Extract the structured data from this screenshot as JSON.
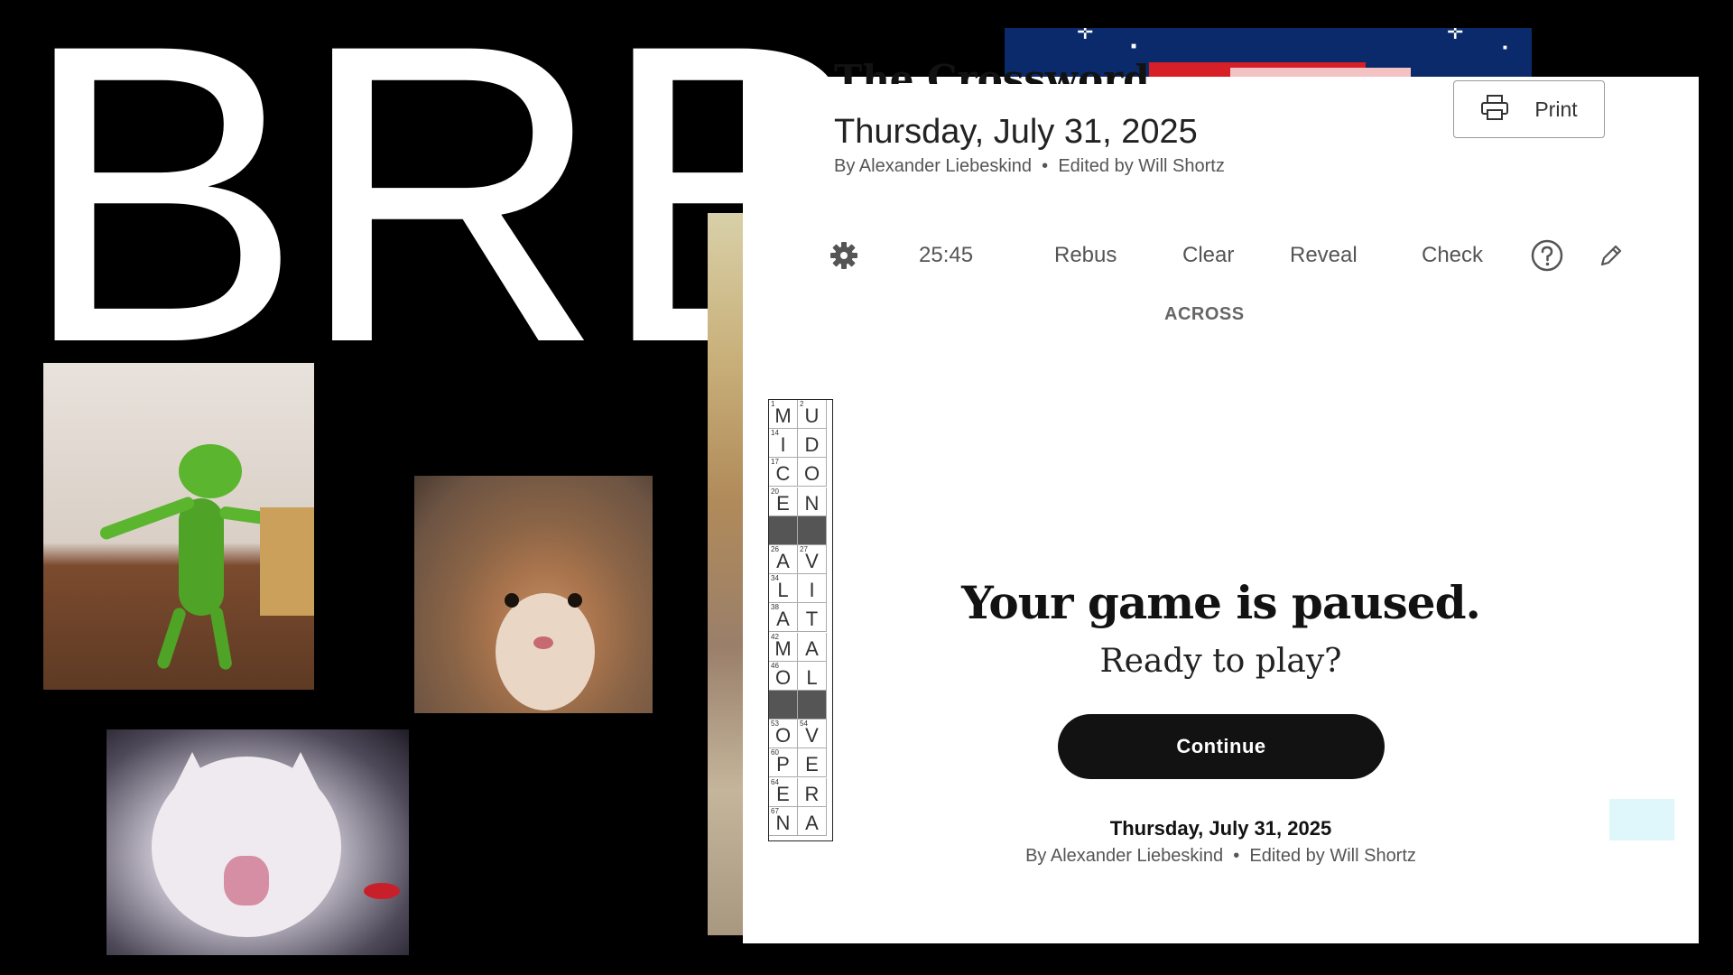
{
  "overlay": {
    "brb_text": "BRB"
  },
  "puzzle": {
    "title_cut": "The Crossword",
    "date": "Thursday, July 31, 2025",
    "author": "By Alexander Liebeskind",
    "separator": "•",
    "editor": "Edited by Will Shortz",
    "print_label": "Print"
  },
  "toolbar": {
    "timer": "25:45",
    "rebus": "Rebus",
    "clear": "Clear",
    "reveal": "Reveal",
    "check": "Check"
  },
  "clues": {
    "across_heading": "ACROSS"
  },
  "grid": {
    "rows": [
      [
        {
          "n": "1",
          "l": "M"
        },
        {
          "n": "2",
          "l": "U"
        }
      ],
      [
        {
          "n": "14",
          "l": "I"
        },
        {
          "n": "",
          "l": "D"
        }
      ],
      [
        {
          "n": "17",
          "l": "C"
        },
        {
          "n": "",
          "l": "O"
        }
      ],
      [
        {
          "n": "20",
          "l": "E"
        },
        {
          "n": "",
          "l": "N"
        }
      ],
      [
        {
          "black": true
        },
        {
          "black": true
        }
      ],
      [
        {
          "n": "26",
          "l": "A"
        },
        {
          "n": "27",
          "l": "V"
        }
      ],
      [
        {
          "n": "34",
          "l": "L"
        },
        {
          "n": "",
          "l": "I"
        }
      ],
      [
        {
          "n": "38",
          "l": "A"
        },
        {
          "n": "",
          "l": "T"
        }
      ],
      [
        {
          "n": "42",
          "l": "M"
        },
        {
          "n": "",
          "l": "A"
        }
      ],
      [
        {
          "n": "46",
          "l": "O"
        },
        {
          "n": "",
          "l": "L"
        }
      ],
      [
        {
          "black": true
        },
        {
          "black": true
        }
      ],
      [
        {
          "n": "53",
          "l": "O"
        },
        {
          "n": "54",
          "l": "V"
        }
      ],
      [
        {
          "n": "60",
          "l": "P"
        },
        {
          "n": "",
          "l": "E"
        }
      ],
      [
        {
          "n": "64",
          "l": "E"
        },
        {
          "n": "",
          "l": "R"
        }
      ],
      [
        {
          "n": "67",
          "l": "N"
        },
        {
          "n": "",
          "l": "A"
        }
      ]
    ]
  },
  "pause_modal": {
    "title": "Your game is paused.",
    "subtitle": "Ready to play?",
    "continue_label": "Continue",
    "date": "Thursday, July 31, 2025",
    "author": "By Alexander Liebeskind",
    "separator": "•",
    "editor": "Edited by Will Shortz"
  },
  "icons": {
    "settings": "gear-icon",
    "help": "help-circle-icon",
    "pencil": "pencil-icon",
    "print": "printer-icon"
  },
  "colors": {
    "background": "#000000",
    "panel": "#ffffff",
    "button_dark": "#121212",
    "flag_blue": "#0a2a6b",
    "flag_red": "#d61f26"
  }
}
